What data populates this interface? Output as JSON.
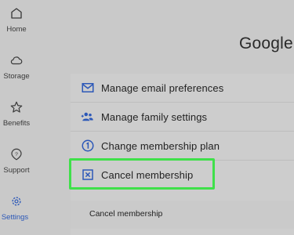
{
  "app_title": "Google",
  "sidebar": {
    "items": [
      {
        "label": "Home",
        "icon": "home-icon",
        "active": false
      },
      {
        "label": "Storage",
        "icon": "cloud-icon",
        "active": false
      },
      {
        "label": "Benefits",
        "icon": "star-icon",
        "active": false
      },
      {
        "label": "Support",
        "icon": "support-icon",
        "active": false
      },
      {
        "label": "Settings",
        "icon": "gear-icon",
        "active": true
      }
    ]
  },
  "menu": {
    "items": [
      {
        "label": "Manage email preferences",
        "icon": "mail-icon"
      },
      {
        "label": "Manage family settings",
        "icon": "family-icon"
      },
      {
        "label": "Change membership plan",
        "icon": "number-one-icon"
      },
      {
        "label": "Cancel membership",
        "icon": "cancel-box-icon"
      }
    ],
    "sub_action_label": "Cancel membership"
  },
  "colors": {
    "accent": "#2c58b8",
    "highlight": "#3fe04a",
    "background": "#c9c9c9"
  }
}
